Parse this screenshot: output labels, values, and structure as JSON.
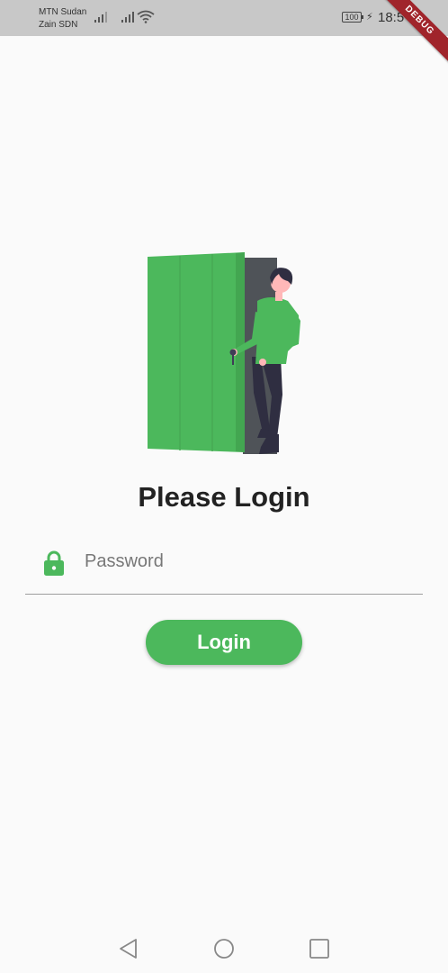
{
  "status_bar": {
    "carrier_1": "MTN Sudan",
    "carrier_2": "Zain SDN",
    "battery": "100",
    "time": "18:5"
  },
  "debug_banner": "DEBUG",
  "title": "Please Login",
  "password": {
    "placeholder": "Password",
    "value": ""
  },
  "login_button": "Login",
  "colors": {
    "accent": "#4cb85c",
    "door_frame": "#4f5358",
    "door": "#4cb85c",
    "text": "#222222",
    "status_bar_bg": "#c8c8c8",
    "debug_banner": "#a0242b"
  },
  "icons": {
    "password_prefix": "lock-icon",
    "nav_back": "triangle-back-icon",
    "nav_home": "circle-home-icon",
    "nav_recent": "square-recent-icon"
  }
}
